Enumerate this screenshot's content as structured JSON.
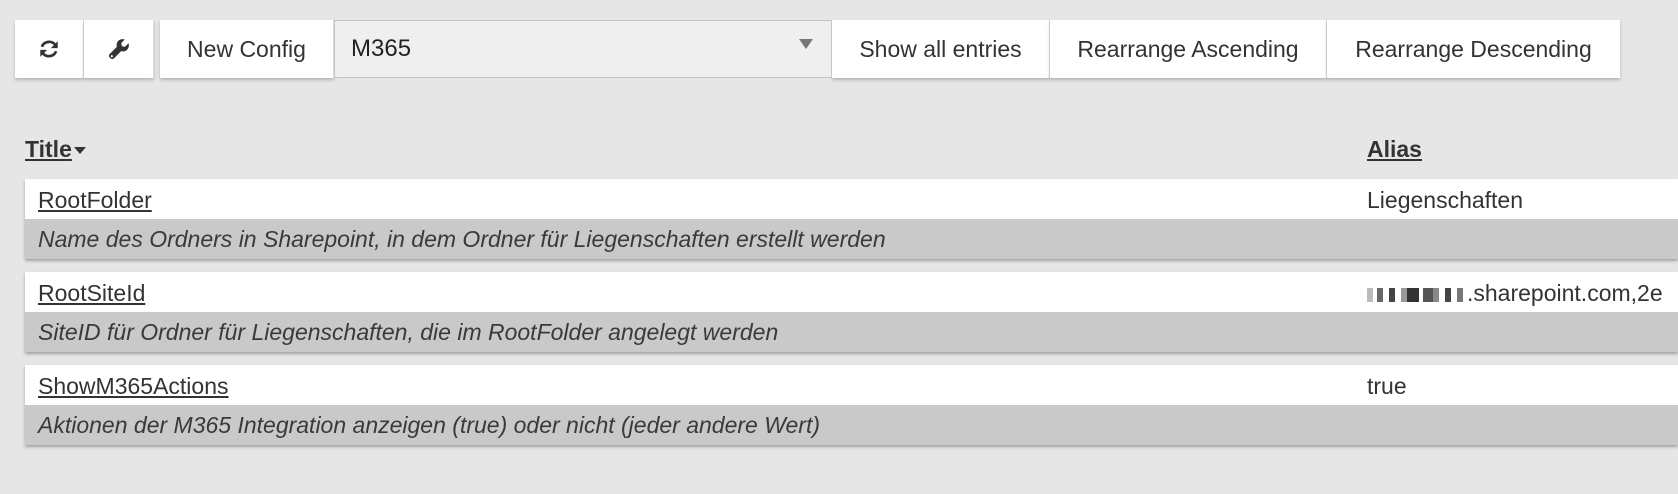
{
  "toolbar": {
    "refresh_icon": "refresh-icon",
    "settings_icon": "wrench-icon",
    "new_config_label": "New Config",
    "config_select_value": "M365",
    "show_all_label": "Show all entries",
    "asc_label": "Rearrange Ascending",
    "desc_label": "Rearrange Descending"
  },
  "table": {
    "headers": {
      "title": "Title",
      "alias": "Alias"
    },
    "rows": [
      {
        "title": "RootFolder",
        "alias": "Liegenschaften",
        "description": "Name des Ordners in Sharepoint, in dem Ordner für Liegenschaften erstellt werden"
      },
      {
        "title": "RootSiteId",
        "alias": ".sharepoint.com,2e",
        "description": "SiteID für Ordner für Liegenschaften, die im RootFolder angelegt werden"
      },
      {
        "title": "ShowM365Actions",
        "alias": "true",
        "description": "Aktionen der M365 Integration anzeigen (true) oder nicht (jeder andere Wert)"
      }
    ]
  },
  "colors": {
    "background": "#e6e6e6",
    "row_top": "#ffffff",
    "row_description": "#c9c9c9",
    "text": "#333333"
  }
}
